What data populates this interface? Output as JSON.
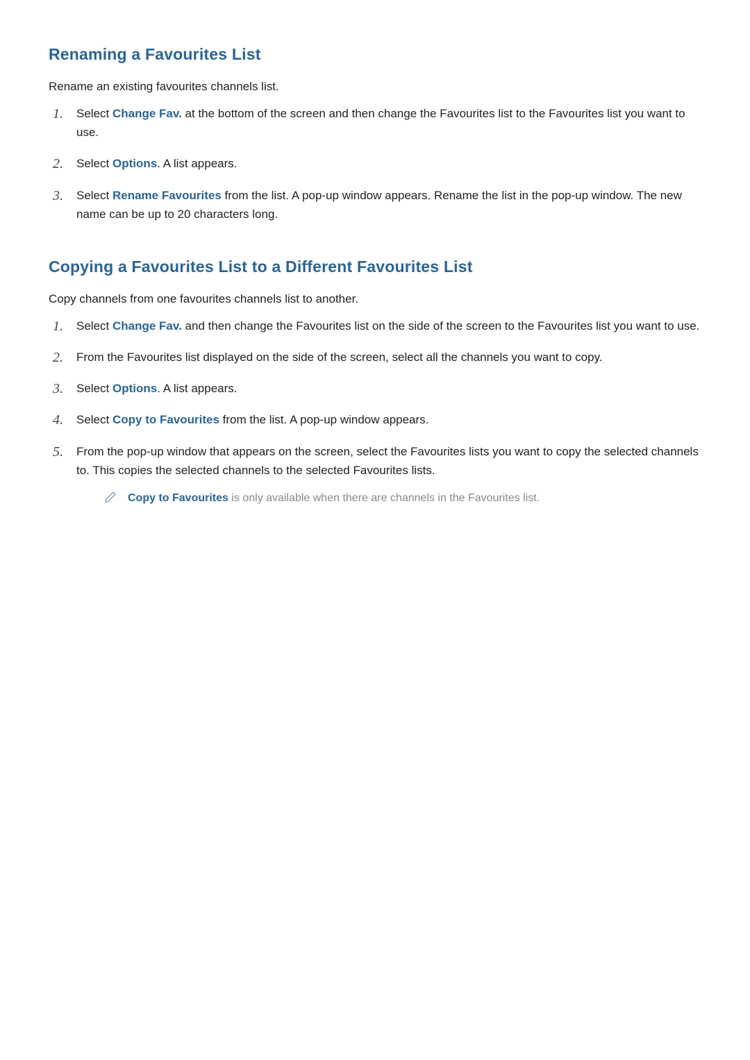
{
  "section1": {
    "title": "Renaming a Favourites List",
    "intro": "Rename an existing favourites channels list.",
    "items": [
      {
        "num": "1.",
        "pre": "Select ",
        "kw": "Change Fav.",
        "post": " at the bottom of the screen and then change the Favourites list to the Favourites list you want to use."
      },
      {
        "num": "2.",
        "pre": "Select ",
        "kw": "Options",
        "post": ". A list appears."
      },
      {
        "num": "3.",
        "pre": "Select ",
        "kw": "Rename Favourites",
        "post": " from the list. A pop-up window appears. Rename the list in the pop-up window. The new name can be up to 20 characters long."
      }
    ]
  },
  "section2": {
    "title": "Copying a Favourites List to a Different Favourites List",
    "intro": "Copy channels from one favourites channels list to another.",
    "items": [
      {
        "num": "1.",
        "pre": "Select ",
        "kw": "Change Fav.",
        "post": " and then change the Favourites list on the side of the screen to the Favourites list you want to use."
      },
      {
        "num": "2.",
        "pre": "From the Favourites list displayed on the side of the screen, select all the channels you want to copy.",
        "kw": "",
        "post": ""
      },
      {
        "num": "3.",
        "pre": "Select ",
        "kw": "Options",
        "post": ". A list appears."
      },
      {
        "num": "4.",
        "pre": "Select ",
        "kw": "Copy to Favourites",
        "post": " from the list. A pop-up window appears."
      },
      {
        "num": "5.",
        "pre": "From the pop-up window that appears on the screen, select the Favourites lists you want to copy the selected channels to. This copies the selected channels to the selected Favourites lists.",
        "kw": "",
        "post": ""
      }
    ],
    "note": {
      "kw": "Copy to Favourites",
      "post": " is only available when there are channels in the Favourites list."
    }
  }
}
